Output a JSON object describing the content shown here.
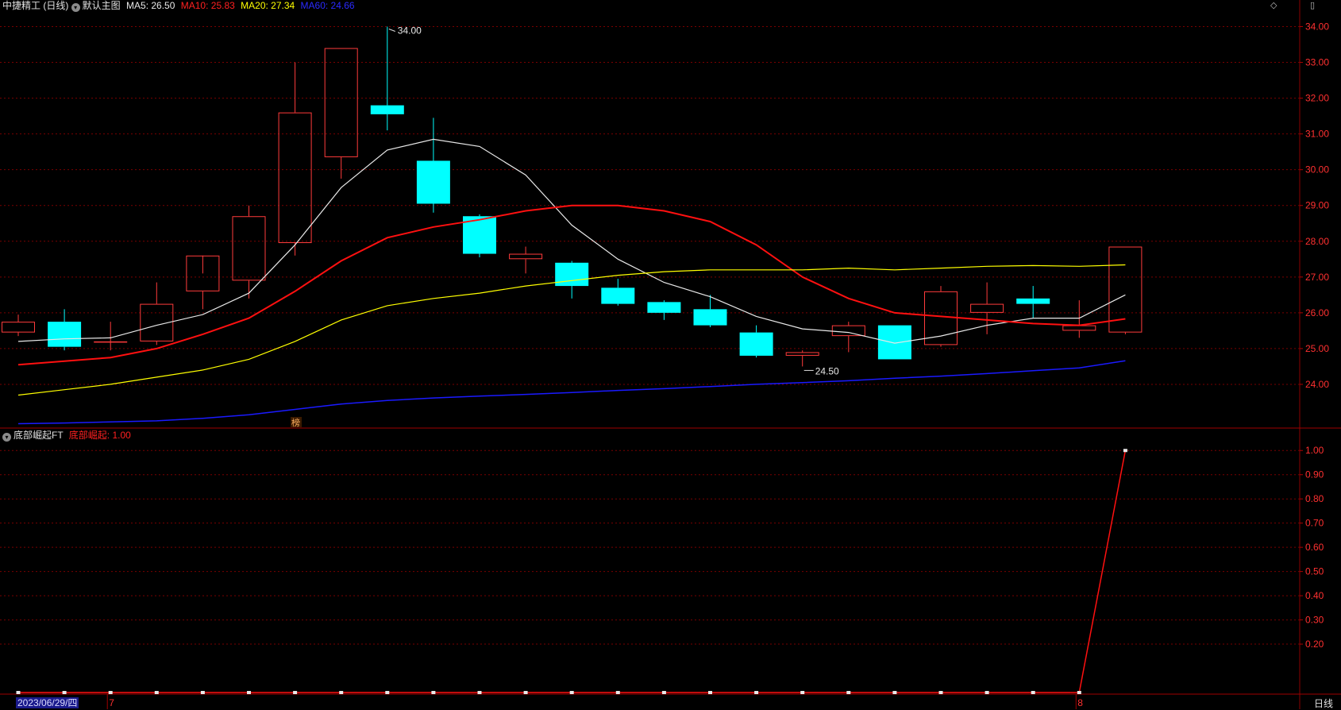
{
  "header": {
    "title": "中捷精工 (日线)",
    "main_label": "默认主图",
    "ma_items": [
      {
        "label": "MA5: 26.50",
        "color": "#e8e8e8"
      },
      {
        "label": "MA10: 25.83",
        "color": "#ff2020"
      },
      {
        "label": "MA20: 27.34",
        "color": "#ffff00"
      },
      {
        "label": "MA60: 24.66",
        "color": "#2a2aff"
      }
    ]
  },
  "sub_header": {
    "indicator_name": "底部崛起FT",
    "value_label": "底部崛起: 1.00",
    "value_color": "#ff2020"
  },
  "footer": {
    "date": "2023/06/29/四",
    "month_marks": [
      "7",
      "8"
    ],
    "period": "日线"
  },
  "annotations": {
    "badge": "榜",
    "high": "34.00",
    "low": "24.50"
  },
  "colors": {
    "up": "#ff3b3b",
    "down": "#00ffff",
    "grid": "#7a0000",
    "axis_text": "#ff3030",
    "ma5": "#e8e8e8",
    "ma10": "#ff1010",
    "ma20": "#ffff00",
    "ma60": "#1a1aff"
  },
  "chart_data": [
    {
      "type": "candlestick",
      "title": "中捷精工 (日线)",
      "y_ticks": [
        "34.00",
        "33.00",
        "32.00",
        "31.00",
        "30.00",
        "29.00",
        "28.00",
        "27.00",
        "26.00",
        "25.00",
        "24.00"
      ],
      "ylim": [
        22.8,
        34.3
      ],
      "candles": [
        {
          "o": 25.45,
          "h": 25.95,
          "l": 25.35,
          "c": 25.75
        },
        {
          "o": 25.75,
          "h": 26.1,
          "l": 24.95,
          "c": 25.05
        },
        {
          "o": 25.2,
          "h": 25.75,
          "l": 24.95,
          "c": 25.2
        },
        {
          "o": 25.2,
          "h": 26.85,
          "l": 25.1,
          "c": 26.25
        },
        {
          "o": 26.6,
          "h": 27.1,
          "l": 26.1,
          "c": 27.6
        },
        {
          "o": 26.9,
          "h": 29.0,
          "l": 26.4,
          "c": 28.7
        },
        {
          "o": 27.95,
          "h": 33.0,
          "l": 27.6,
          "c": 31.6
        },
        {
          "o": 30.35,
          "h": 33.4,
          "l": 29.75,
          "c": 33.4
        },
        {
          "o": 31.8,
          "h": 34.0,
          "l": 31.1,
          "c": 31.55
        },
        {
          "o": 30.25,
          "h": 31.45,
          "l": 28.8,
          "c": 29.05
        },
        {
          "o": 28.7,
          "h": 28.75,
          "l": 27.55,
          "c": 27.65
        },
        {
          "o": 27.5,
          "h": 27.85,
          "l": 27.1,
          "c": 27.65
        },
        {
          "o": 27.4,
          "h": 27.45,
          "l": 26.4,
          "c": 26.75
        },
        {
          "o": 26.7,
          "h": 26.95,
          "l": 26.2,
          "c": 26.25
        },
        {
          "o": 26.3,
          "h": 26.35,
          "l": 25.8,
          "c": 26.0
        },
        {
          "o": 26.1,
          "h": 26.5,
          "l": 25.6,
          "c": 25.65
        },
        {
          "o": 25.45,
          "h": 25.65,
          "l": 24.75,
          "c": 24.8
        },
        {
          "o": 24.8,
          "h": 24.95,
          "l": 24.5,
          "c": 24.9
        },
        {
          "o": 25.35,
          "h": 25.75,
          "l": 24.9,
          "c": 25.65
        },
        {
          "o": 25.65,
          "h": 25.65,
          "l": 24.7,
          "c": 24.7
        },
        {
          "o": 25.1,
          "h": 26.75,
          "l": 25.05,
          "c": 26.6
        },
        {
          "o": 26.0,
          "h": 26.85,
          "l": 25.4,
          "c": 26.25
        },
        {
          "o": 26.4,
          "h": 26.75,
          "l": 25.85,
          "c": 26.25
        },
        {
          "o": 25.5,
          "h": 26.35,
          "l": 25.3,
          "c": 25.65
        },
        {
          "o": 25.45,
          "h": 27.85,
          "l": 25.4,
          "c": 27.85
        }
      ],
      "series": [
        {
          "name": "MA5",
          "values": [
            25.2,
            25.27,
            25.3,
            25.65,
            25.95,
            26.55,
            27.9,
            29.5,
            30.55,
            30.85,
            30.65,
            29.85,
            28.45,
            27.5,
            26.85,
            26.45,
            25.9,
            25.55,
            25.45,
            25.15,
            25.35,
            25.65,
            25.85,
            25.85,
            26.5
          ]
        },
        {
          "name": "MA10",
          "values": [
            24.55,
            24.65,
            24.75,
            25.0,
            25.4,
            25.85,
            26.6,
            27.45,
            28.1,
            28.4,
            28.6,
            28.85,
            29.0,
            29.0,
            28.85,
            28.55,
            27.9,
            27.0,
            26.4,
            26.0,
            25.9,
            25.8,
            25.7,
            25.65,
            25.83
          ]
        },
        {
          "name": "MA20",
          "values": [
            23.7,
            23.85,
            24.0,
            24.2,
            24.4,
            24.7,
            25.2,
            25.8,
            26.2,
            26.4,
            26.55,
            26.75,
            26.9,
            27.05,
            27.15,
            27.2,
            27.2,
            27.2,
            27.25,
            27.2,
            27.25,
            27.3,
            27.32,
            27.3,
            27.34
          ]
        },
        {
          "name": "MA60",
          "values": [
            22.9,
            22.92,
            22.95,
            22.98,
            23.05,
            23.15,
            23.3,
            23.45,
            23.55,
            23.62,
            23.67,
            23.72,
            23.77,
            23.83,
            23.88,
            23.94,
            24.0,
            24.05,
            24.1,
            24.17,
            24.23,
            24.3,
            24.38,
            24.46,
            24.66
          ]
        }
      ]
    },
    {
      "type": "line",
      "title": "底部崛起FT",
      "y_ticks": [
        "1.00",
        "0.90",
        "0.80",
        "0.70",
        "0.60",
        "0.50",
        "0.40",
        "0.30",
        "0.20"
      ],
      "ylim": [
        0.0,
        1.05
      ],
      "series": [
        {
          "name": "底部崛起",
          "values": [
            0,
            0,
            0,
            0,
            0,
            0,
            0,
            0,
            0,
            0,
            0,
            0,
            0,
            0,
            0,
            0,
            0,
            0,
            0,
            0,
            0,
            0,
            0,
            0,
            1.0
          ]
        }
      ]
    }
  ]
}
